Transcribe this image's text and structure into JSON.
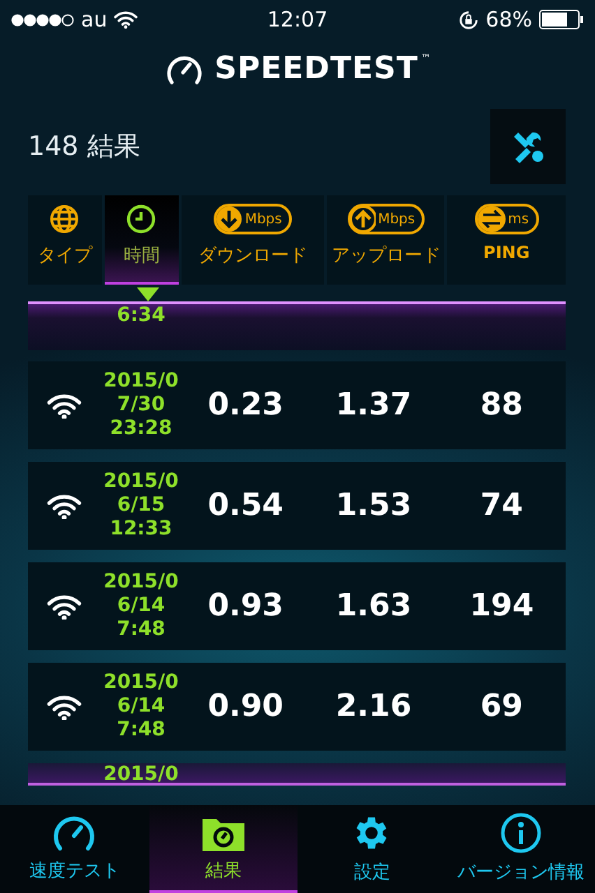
{
  "status_bar": {
    "carrier": "au",
    "time": "12:07",
    "battery": "68%"
  },
  "app_title": "SPEEDTEST",
  "trademark": "™",
  "result_count": "148 結果",
  "columns": [
    {
      "kind": "type",
      "label": "タイプ",
      "selected": false
    },
    {
      "kind": "time",
      "label": "時間",
      "selected": true
    },
    {
      "kind": "download",
      "label": "ダウンロード",
      "unit": "Mbps",
      "selected": false
    },
    {
      "kind": "upload",
      "label": "アップロード",
      "unit": "Mbps",
      "selected": false
    },
    {
      "kind": "ping",
      "label": "PING",
      "unit": "ms",
      "selected": false
    }
  ],
  "rows": [
    {
      "kind": "cut_top",
      "date_lines": [
        "6:34"
      ]
    },
    {
      "kind": "full",
      "date_lines": [
        "2015/0",
        "7/30",
        "23:28"
      ],
      "download": "0.23",
      "upload": "1.37",
      "ping": "88"
    },
    {
      "kind": "full",
      "date_lines": [
        "2015/0",
        "6/15",
        "12:33"
      ],
      "download": "0.54",
      "upload": "1.53",
      "ping": "74"
    },
    {
      "kind": "full",
      "date_lines": [
        "2015/0",
        "6/14",
        "7:48"
      ],
      "download": "0.93",
      "upload": "1.63",
      "ping": "194"
    },
    {
      "kind": "full",
      "date_lines": [
        "2015/0",
        "6/14",
        "7:48"
      ],
      "download": "0.90",
      "upload": "2.16",
      "ping": "69"
    },
    {
      "kind": "cut_bottom",
      "date_lines": [
        "2015/0"
      ]
    }
  ],
  "tab_bar": [
    {
      "kind": "speed",
      "label": "速度テスト",
      "selected": false
    },
    {
      "kind": "results",
      "label": "結果",
      "selected": true
    },
    {
      "kind": "settings",
      "label": "設定",
      "selected": false
    },
    {
      "kind": "info",
      "label": "バージョン情報",
      "selected": false
    }
  ]
}
